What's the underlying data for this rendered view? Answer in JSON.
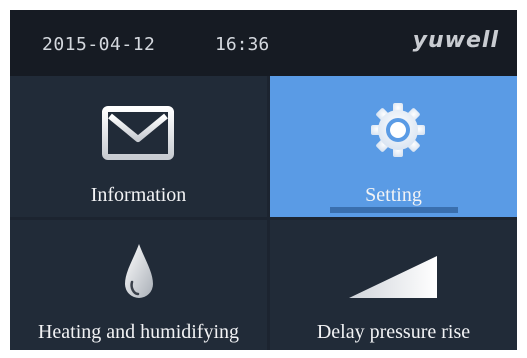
{
  "status": {
    "date": "2015-04-12",
    "time": "16:36",
    "brand": "yuwell"
  },
  "menu": {
    "selected": "Setting",
    "tiles": [
      {
        "label": "Information",
        "icon": "envelope-icon"
      },
      {
        "label": "Setting",
        "icon": "gear-icon"
      },
      {
        "label": "Heating and humidifying",
        "icon": "water-drop-icon"
      },
      {
        "label": "Delay pressure rise",
        "icon": "ramp-icon"
      }
    ]
  },
  "colors": {
    "background": "#1c2430",
    "statusbar": "#161b23",
    "tile": "#212b38",
    "selected_tile": "#5a9be5",
    "text": "#f2f3f5"
  }
}
